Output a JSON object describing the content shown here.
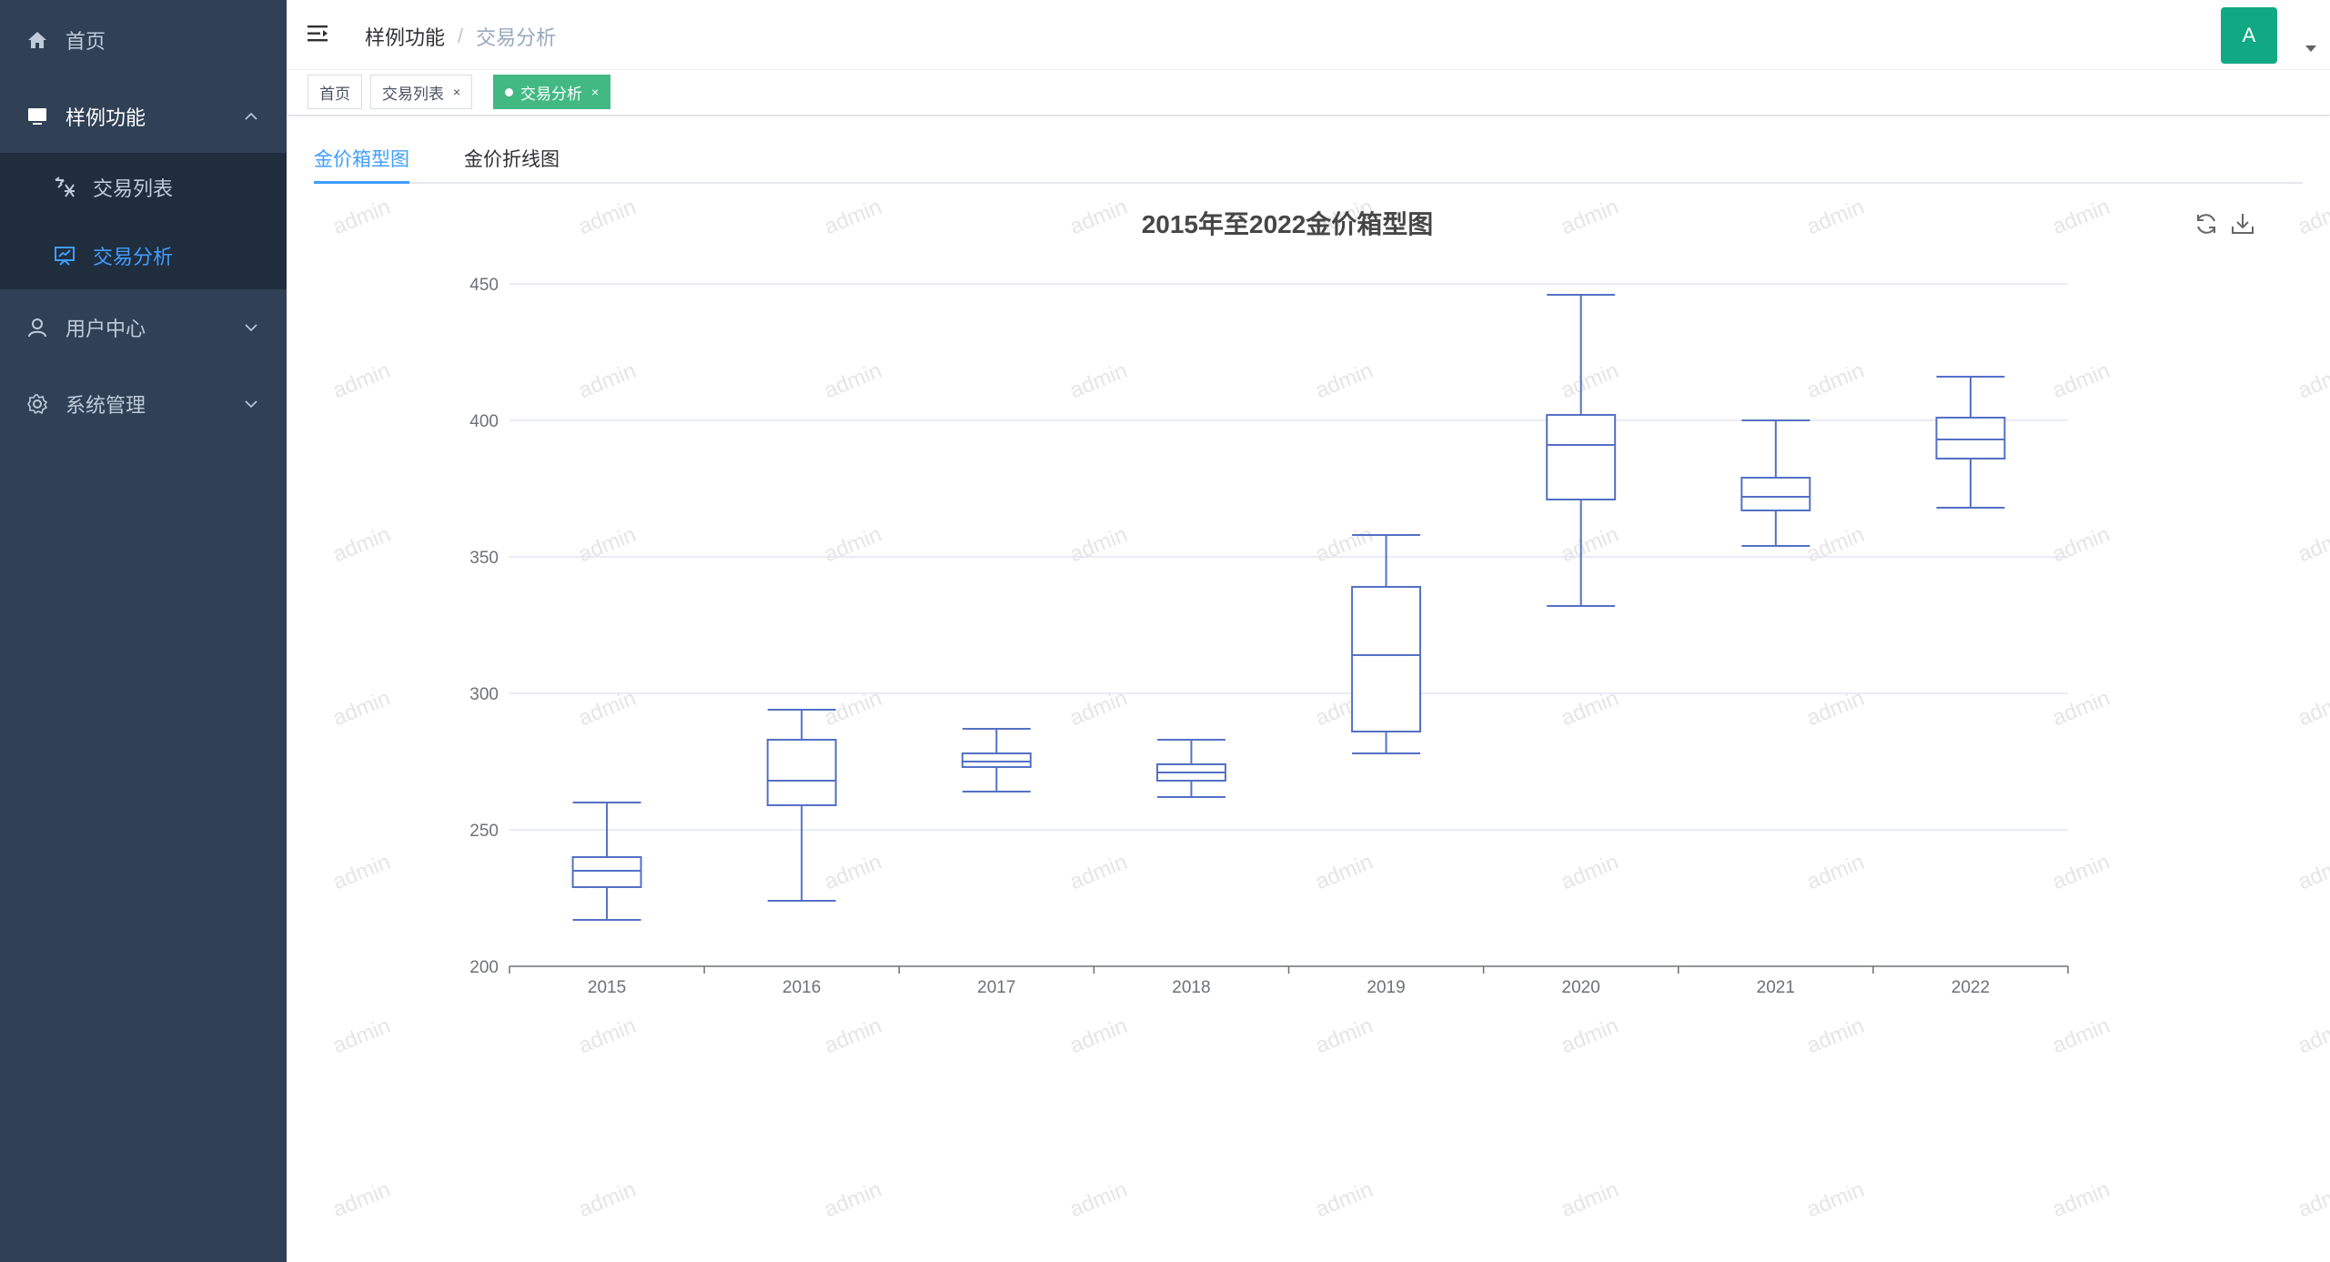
{
  "sidebar": {
    "items": [
      {
        "label": "首页",
        "icon": "home-icon"
      },
      {
        "label": "样例功能",
        "icon": "monitor-icon",
        "expanded": true,
        "children": [
          {
            "label": "交易列表",
            "icon": "exchange-icon"
          },
          {
            "label": "交易分析",
            "icon": "presentation-icon",
            "active": true
          }
        ]
      },
      {
        "label": "用户中心",
        "icon": "user-icon"
      },
      {
        "label": "系统管理",
        "icon": "gear-icon"
      }
    ]
  },
  "navbar": {
    "breadcrumb": [
      "样例功能",
      "交易分析"
    ],
    "breadcrumb_separator": "/",
    "avatar_letter": "A"
  },
  "tags": [
    {
      "label": "首页"
    },
    {
      "label": "交易列表",
      "close": "×"
    },
    {
      "label": "交易分析",
      "close": "×",
      "active": true
    }
  ],
  "tabs": [
    {
      "label": "金价箱型图",
      "active": true
    },
    {
      "label": "金价折线图"
    }
  ],
  "watermark_text": "admin",
  "colors": {
    "sidebar_bg": "#304156",
    "submenu_bg": "#1f2d3d",
    "accent": "#409eff",
    "tag_active": "#42b983",
    "avatar": "#11a983",
    "box_stroke": "#5470c6"
  },
  "chart_data": {
    "type": "boxplot",
    "title": "2015年至2022金价箱型图",
    "categories": [
      "2015",
      "2016",
      "2017",
      "2018",
      "2019",
      "2020",
      "2021",
      "2022"
    ],
    "boxes": [
      {
        "min": 217,
        "q1": 229,
        "median": 235,
        "q3": 240,
        "max": 260
      },
      {
        "min": 224,
        "q1": 259,
        "median": 268,
        "q3": 283,
        "max": 294
      },
      {
        "min": 264,
        "q1": 273,
        "median": 275,
        "q3": 278,
        "max": 287
      },
      {
        "min": 262,
        "q1": 268,
        "median": 271,
        "q3": 274,
        "max": 283
      },
      {
        "min": 278,
        "q1": 286,
        "median": 314,
        "q3": 339,
        "max": 358
      },
      {
        "min": 332,
        "q1": 371,
        "median": 391,
        "q3": 402,
        "max": 446
      },
      {
        "min": 354,
        "q1": 367,
        "median": 372,
        "q3": 379,
        "max": 400
      },
      {
        "min": 368,
        "q1": 386,
        "median": 393,
        "q3": 401,
        "max": 416
      }
    ],
    "ylim": [
      200,
      450
    ],
    "yticks": [
      200,
      250,
      300,
      350,
      400,
      450
    ],
    "grid": true
  }
}
